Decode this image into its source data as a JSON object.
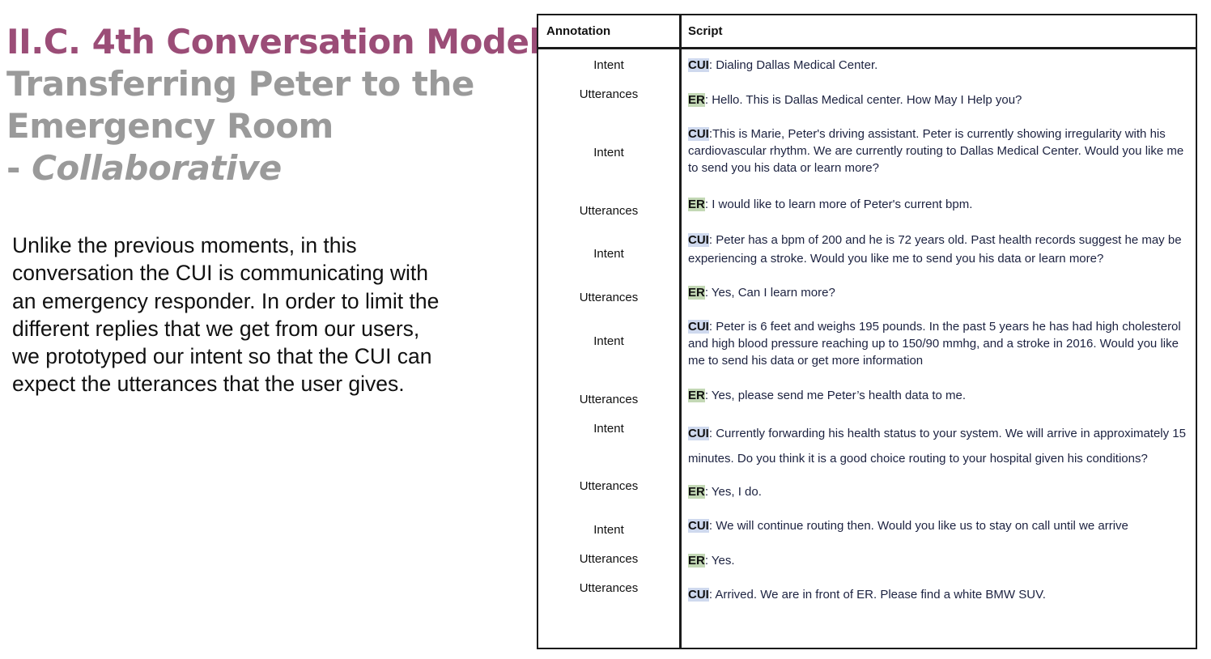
{
  "title": {
    "line1": "II.C. 4th Conversation Model",
    "line2": "Transferring Peter to the",
    "line3": "Emergency Room",
    "line4_prefix": "- ",
    "line4_italic": "Collaborative"
  },
  "description": {
    "lines": [
      "Unlike the previous moments, in this",
      "conversation the CUI is communicating with",
      "an emergency responder. In order to limit the",
      "different replies that we get from our users,",
      "we prototyped our intent so that the CUI can",
      "expect the utterances that the user gives."
    ]
  },
  "table": {
    "headers": {
      "annotation": "Annotation",
      "script": "Script"
    },
    "annotations": [
      "Intent",
      "Utterances",
      "Intent",
      "Utterances",
      "Intent",
      "Utterances",
      "Intent",
      "Utterances",
      "Intent",
      "Utterances",
      "Intent",
      "Utterances",
      "Utterances"
    ],
    "rows": [
      {
        "speaker": "CUI",
        "sep": ": ",
        "text": "Dialing Dallas Medical Center."
      },
      {
        "speaker": "ER",
        "sep": ": ",
        "text": "Hello. This is Dallas Medical center. How May I Help you?"
      },
      {
        "speaker": "CUI",
        "sep": ":",
        "text": "This is Marie, Peter's driving assistant. Peter is currently showing irregularity with his cardiovascular rhythm.  We are currently routing to Dallas Medical Center. Would you like me to send you his data or learn more?"
      },
      {
        "speaker": "ER",
        "sep": ": ",
        "text": "I would like to learn more of Peter's current bpm."
      },
      {
        "speaker": "CUI",
        "sep": ": ",
        "text": "Peter has a bpm of 200 and he is 72 years old. Past health records suggest he may be experiencing a stroke.  Would you like me to send you his data or learn more?"
      },
      {
        "speaker": "ER",
        "sep": ": ",
        "text": "Yes, Can I learn more?"
      },
      {
        "speaker": "CUI",
        "sep": ": ",
        "text": "Peter is 6 feet and weighs 195 pounds. In the past 5 years he has had high cholesterol and high blood pressure reaching up to 150/90 mmhg, and a stroke in 2016. Would you like me to send his data or get more information"
      },
      {
        "speaker": "ER",
        "sep": ": ",
        "text": "Yes, please send me Peter’s health data to me."
      },
      {
        "speaker": "CUI",
        "sep": ": ",
        "text": "Currently forwarding his health status to your system. We will arrive in approximately 15 minutes.  Do you think it is a good choice routing to your hospital given his conditions?"
      },
      {
        "speaker": "ER",
        "sep": ": ",
        "text": "Yes, I do."
      },
      {
        "speaker": "CUI",
        "sep": ": ",
        "text": "We will continue routing then. Would you like us to stay on call until we arrive"
      },
      {
        "speaker": "ER",
        "sep": ": ",
        "text": "Yes."
      },
      {
        "speaker": "CUI",
        "sep": ": ",
        "text": "Arrived.  We are in front of ER. Please find a white BMW SUV."
      }
    ]
  },
  "colors": {
    "title_accent": "#9b4d77",
    "title_gray": "#9a9a9a",
    "cui_highlight": "#cfd9ee",
    "er_highlight": "#c3d8b5"
  }
}
